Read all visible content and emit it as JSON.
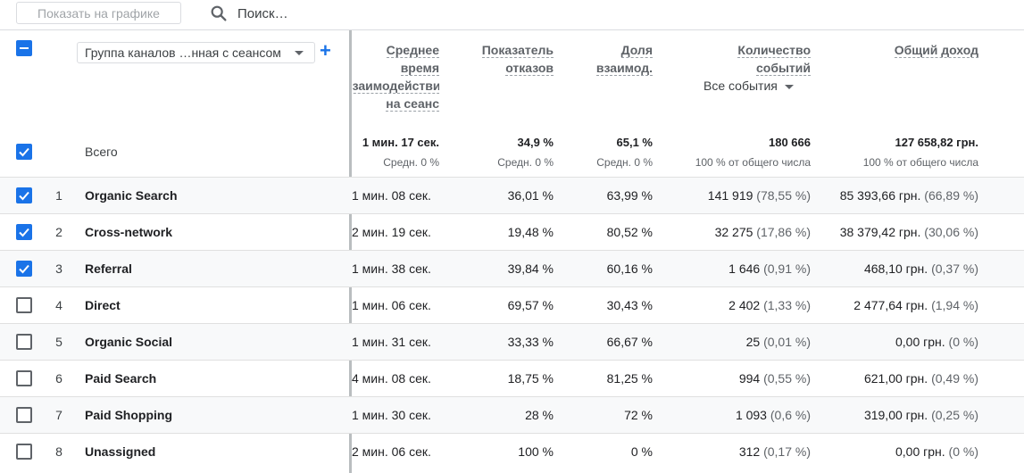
{
  "toolbar": {
    "plot_button_label": "Показать на графике",
    "search_placeholder": "Поиск…"
  },
  "header": {
    "dimension_select_label": "Группа каналов …нная с сеансом",
    "columns": [
      {
        "lines": [
          "Среднее время",
          "взаимодействия",
          "на сеанс"
        ]
      },
      {
        "lines": [
          "Показатель",
          "отказов"
        ]
      },
      {
        "lines": [
          "Доля",
          "взаимод."
        ]
      },
      {
        "lines": [
          "Количество",
          "событий"
        ]
      },
      {
        "lines": [
          "Общий доход"
        ]
      }
    ],
    "events_select_label": "Все события"
  },
  "totals": {
    "label": "Всего",
    "values": [
      {
        "value": "1 мин. 17 сек.",
        "sub": "Средн. 0 %"
      },
      {
        "value": "34,9 %",
        "sub": "Средн. 0 %"
      },
      {
        "value": "65,1 %",
        "sub": "Средн. 0 %"
      },
      {
        "value": "180 666",
        "sub": "100 % от общего числа"
      },
      {
        "value": "127 658,82 грн.",
        "sub": "100 % от общего числа"
      }
    ]
  },
  "rows": [
    {
      "checked": true,
      "index": "1",
      "channel": "Organic Search",
      "time": "1 мин. 08 сек.",
      "bounce": "36,01 %",
      "engaged": "63,99 %",
      "events": "141 919",
      "events_pct": "(78,55 %)",
      "revenue": "85 393,66 грн.",
      "revenue_pct": "(66,89 %)"
    },
    {
      "checked": true,
      "index": "2",
      "channel": "Cross-network",
      "time": "2 мин. 19 сек.",
      "bounce": "19,48 %",
      "engaged": "80,52 %",
      "events": "32 275",
      "events_pct": "(17,86 %)",
      "revenue": "38 379,42 грн.",
      "revenue_pct": "(30,06 %)"
    },
    {
      "checked": true,
      "index": "3",
      "channel": "Referral",
      "time": "1 мин. 38 сек.",
      "bounce": "39,84 %",
      "engaged": "60,16 %",
      "events": "1 646",
      "events_pct": "(0,91 %)",
      "revenue": "468,10 грн.",
      "revenue_pct": "(0,37 %)"
    },
    {
      "checked": false,
      "index": "4",
      "channel": "Direct",
      "time": "1 мин. 06 сек.",
      "bounce": "69,57 %",
      "engaged": "30,43 %",
      "events": "2 402",
      "events_pct": "(1,33 %)",
      "revenue": "2 477,64 грн.",
      "revenue_pct": "(1,94 %)"
    },
    {
      "checked": false,
      "index": "5",
      "channel": "Organic Social",
      "time": "1 мин. 31 сек.",
      "bounce": "33,33 %",
      "engaged": "66,67 %",
      "events": "25",
      "events_pct": "(0,01 %)",
      "revenue": "0,00 грн.",
      "revenue_pct": "(0 %)"
    },
    {
      "checked": false,
      "index": "6",
      "channel": "Paid Search",
      "time": "4 мин. 08 сек.",
      "bounce": "18,75 %",
      "engaged": "81,25 %",
      "events": "994",
      "events_pct": "(0,55 %)",
      "revenue": "621,00 грн.",
      "revenue_pct": "(0,49 %)"
    },
    {
      "checked": false,
      "index": "7",
      "channel": "Paid Shopping",
      "time": "1 мин. 30 сек.",
      "bounce": "28 %",
      "engaged": "72 %",
      "events": "1 093",
      "events_pct": "(0,6 %)",
      "revenue": "319,00 грн.",
      "revenue_pct": "(0,25 %)"
    },
    {
      "checked": false,
      "index": "8",
      "channel": "Unassigned",
      "time": "2 мин. 06 сек.",
      "bounce": "100 %",
      "engaged": "0 %",
      "events": "312",
      "events_pct": "(0,17 %)",
      "revenue": "0,00 грн.",
      "revenue_pct": "(0 %)"
    }
  ],
  "colors": {
    "accent": "#1a73e8",
    "row_shade": "#f8f9fa",
    "divider": "#80868b"
  },
  "icons": {
    "search": "search-icon",
    "add": "plus-icon",
    "dropdown": "caret-down-icon",
    "check": "check-icon"
  }
}
